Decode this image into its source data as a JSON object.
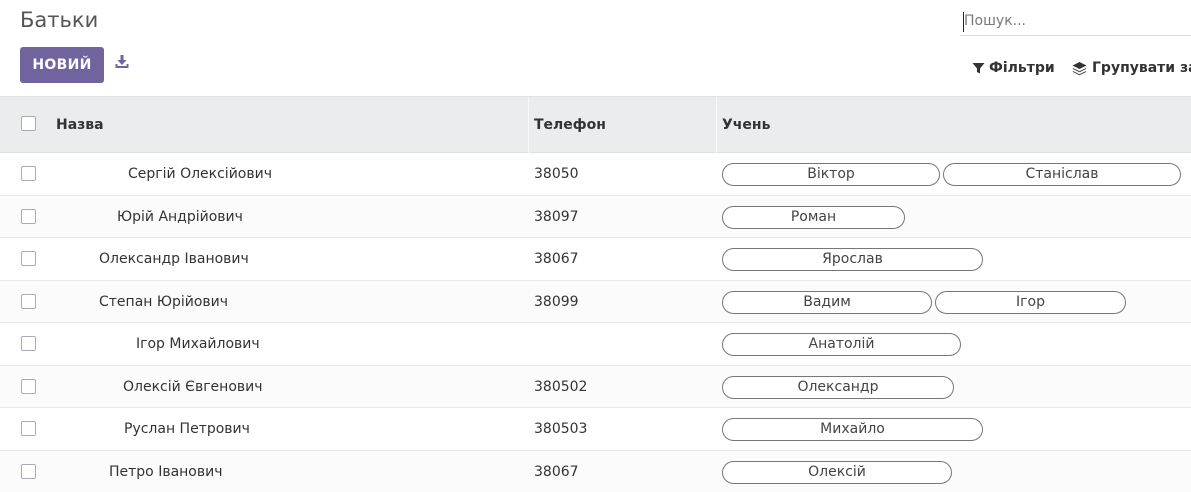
{
  "page": {
    "title": "Батьки"
  },
  "search": {
    "placeholder": "Пошук..."
  },
  "toolbar": {
    "new_label": "НОВИЙ",
    "filters_label": "Фільтри",
    "group_label": "Групувати за"
  },
  "table": {
    "columns": [
      "Назва",
      "Телефон",
      "Учень"
    ],
    "rows": [
      {
        "name": "Сергій Олексійович",
        "phone": "38050",
        "students": [
          "Віктор",
          "Станіслав"
        ]
      },
      {
        "name": "Юрій Андрійович",
        "phone": "38097",
        "students": [
          "Роман"
        ]
      },
      {
        "name": "Олександр Іванович",
        "phone": "38067",
        "students": [
          "Ярослав"
        ]
      },
      {
        "name": "Степан Юрійович",
        "phone": "38099",
        "students": [
          "Вадим",
          "Ігор"
        ]
      },
      {
        "name": "Ігор Михайлович",
        "phone": "",
        "students": [
          "Анатолій"
        ]
      },
      {
        "name": "Олексій Євгенович",
        "phone": "380502",
        "students": [
          "Олександр"
        ]
      },
      {
        "name": "Руслан Петрович",
        "phone": "380503",
        "students": [
          "Михайло"
        ]
      },
      {
        "name": "Петро Іванович",
        "phone": "38067",
        "students": [
          "Олексій"
        ]
      }
    ]
  },
  "colors": {
    "primary": "#71639e",
    "header_bg": "#eaecee",
    "tag_border": "#777777"
  }
}
